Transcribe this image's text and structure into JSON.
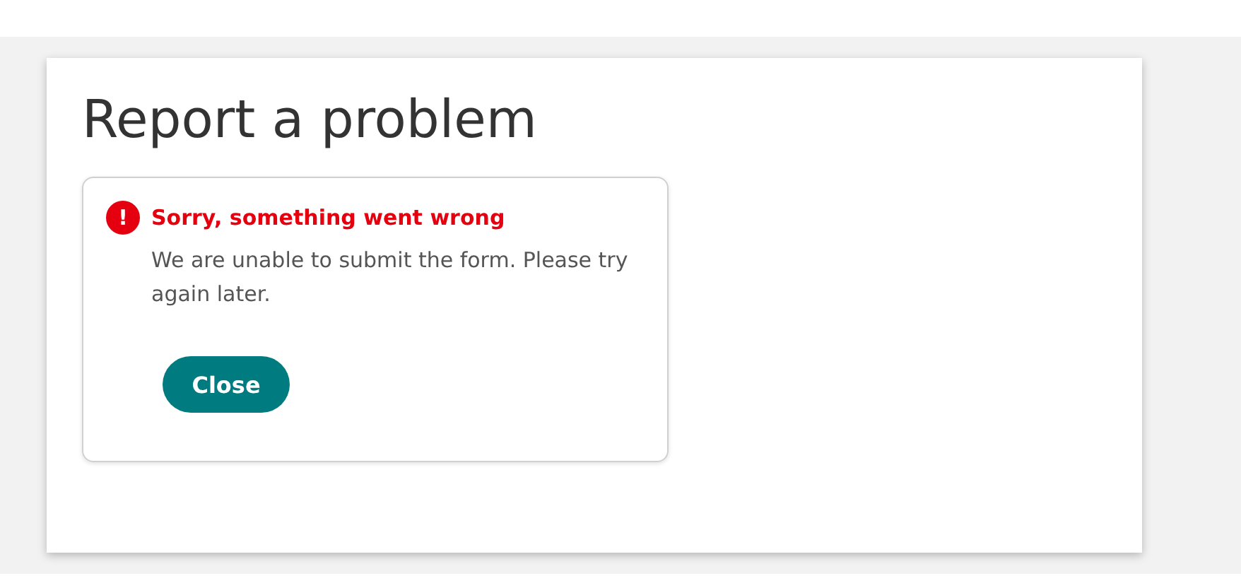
{
  "page": {
    "title": "Report a problem"
  },
  "alert": {
    "kind": "error",
    "heading": "Sorry, something went wrong",
    "message": "We are unable to submit the form. Please try again later.",
    "icon": "!"
  },
  "buttons": [
    "Close"
  ]
}
